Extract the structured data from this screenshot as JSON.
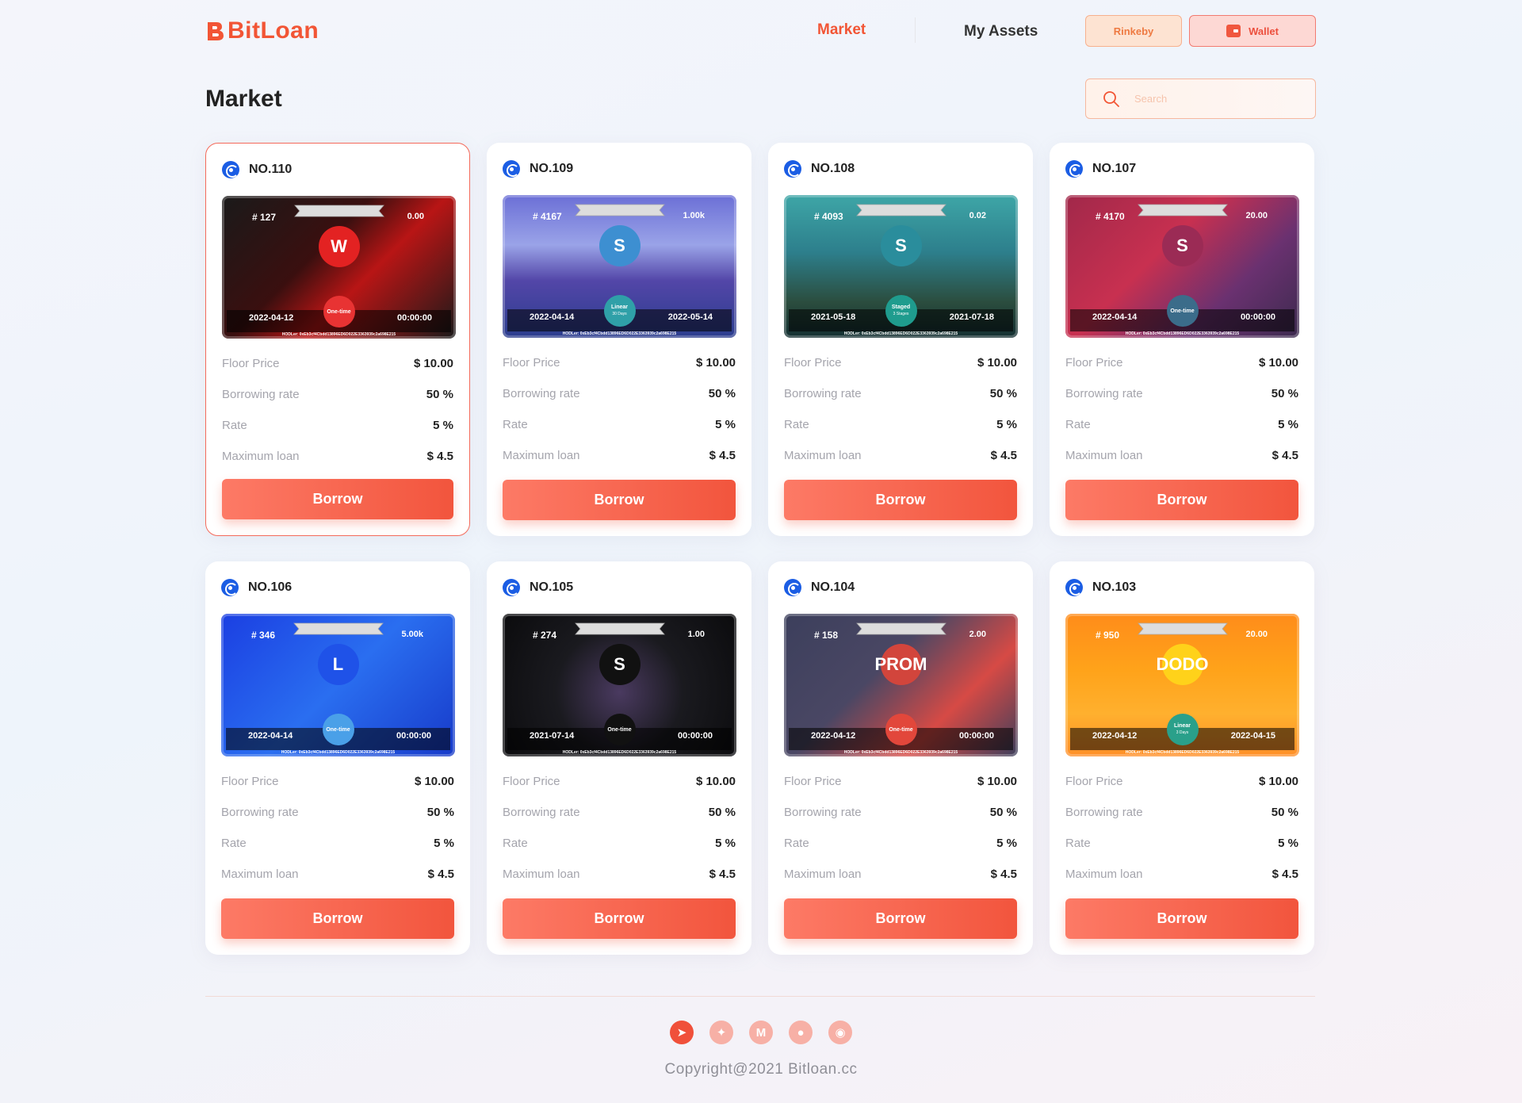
{
  "app": {
    "name": "BitLoan"
  },
  "header": {
    "nav": {
      "market": "Market",
      "my_assets": "My Assets"
    },
    "network_label": "Rinkeby",
    "wallet_label": "Wallet"
  },
  "page": {
    "title": "Market"
  },
  "search": {
    "placeholder": "Search",
    "value": ""
  },
  "card_labels": {
    "floor_price": "Floor Price",
    "borrowing_rate": "Borrowing rate",
    "rate": "Rate",
    "maximum_loan": "Maximum loan",
    "borrow_button": "Borrow"
  },
  "cards": [
    {
      "no": "NO.110",
      "token_id": "# 127",
      "value": "0.00",
      "date_start": "2022-04-12",
      "date_end": "00:00:00",
      "badge": "One-time",
      "badge_sub": "",
      "emblem": "W",
      "holder": "HODLer: 0xEb3cf4Cbdd13896ED6D022E3363939c2a698E215",
      "floor_price": "$ 10.00",
      "borrowing_rate": "50 %",
      "rate": "5 %",
      "maximum_loan": "$ 4.5",
      "theme": "red",
      "selected": true
    },
    {
      "no": "NO.109",
      "token_id": "# 4167",
      "value": "1.00k",
      "date_start": "2022-04-14",
      "date_end": "2022-05-14",
      "badge": "Linear",
      "badge_sub": "30 Days",
      "emblem": "S",
      "holder": "HODLer: 0xEb3cf4Cbdd13896ED6D022E3363939c2a698E215",
      "floor_price": "$ 10.00",
      "borrowing_rate": "50 %",
      "rate": "5 %",
      "maximum_loan": "$ 4.5",
      "theme": "purple",
      "selected": false
    },
    {
      "no": "NO.108",
      "token_id": "# 4093",
      "value": "0.02",
      "date_start": "2021-05-18",
      "date_end": "2021-07-18",
      "badge": "Staged",
      "badge_sub": "3 Stages",
      "emblem": "S",
      "holder": "HODLer: 0xEb3cf4Cbdd13896ED6D022E3363939c2a698E215",
      "floor_price": "$ 10.00",
      "borrowing_rate": "50 %",
      "rate": "5 %",
      "maximum_loan": "$ 4.5",
      "theme": "teal",
      "selected": false
    },
    {
      "no": "NO.107",
      "token_id": "# 4170",
      "value": "20.00",
      "date_start": "2022-04-14",
      "date_end": "00:00:00",
      "badge": "One-time",
      "badge_sub": "",
      "emblem": "S",
      "holder": "HODLer: 0xEb3cf4Cbdd13896ED6D022E3363939c2a698E215",
      "floor_price": "$ 10.00",
      "borrowing_rate": "50 %",
      "rate": "5 %",
      "maximum_loan": "$ 4.5",
      "theme": "crimson",
      "selected": false
    },
    {
      "no": "NO.106",
      "token_id": "# 346",
      "value": "5.00k",
      "date_start": "2022-04-14",
      "date_end": "00:00:00",
      "badge": "One-time",
      "badge_sub": "",
      "emblem": "L",
      "holder": "HODLer: 0xEb3cf4Cbdd13896ED6D022E3363939c2a698E215",
      "floor_price": "$ 10.00",
      "borrowing_rate": "50 %",
      "rate": "5 %",
      "maximum_loan": "$ 4.5",
      "theme": "blue",
      "selected": false
    },
    {
      "no": "NO.105",
      "token_id": "# 274",
      "value": "1.00",
      "date_start": "2021-07-14",
      "date_end": "00:00:00",
      "badge": "One-time",
      "badge_sub": "",
      "emblem": "S",
      "holder": "HODLer: 0xEb3cf4Cbdd13896ED6D022E3363939c2a698E215",
      "floor_price": "$ 10.00",
      "borrowing_rate": "50 %",
      "rate": "5 %",
      "maximum_loan": "$ 4.5",
      "theme": "black",
      "selected": false
    },
    {
      "no": "NO.104",
      "token_id": "# 158",
      "value": "2.00",
      "date_start": "2022-04-12",
      "date_end": "00:00:00",
      "badge": "One-time",
      "badge_sub": "",
      "emblem": "PROM",
      "holder": "HODLer: 0xEb3cf4Cbdd13896ED6D022E3363939c2a698E215",
      "floor_price": "$ 10.00",
      "borrowing_rate": "50 %",
      "rate": "5 %",
      "maximum_loan": "$ 4.5",
      "theme": "slate",
      "selected": false
    },
    {
      "no": "NO.103",
      "token_id": "# 950",
      "value": "20.00",
      "date_start": "2022-04-12",
      "date_end": "2022-04-15",
      "badge": "Linear",
      "badge_sub": "3 Days",
      "emblem": "DODO",
      "holder": "HODLer: 0xEb3cf4Cbdd13896ED6D022E3363939c2a698E215",
      "floor_price": "$ 10.00",
      "borrowing_rate": "50 %",
      "rate": "5 %",
      "maximum_loan": "$ 4.5",
      "theme": "orange",
      "selected": false
    }
  ],
  "themes": {
    "red": {
      "bg": "linear-gradient(135deg,#1a1a1a 0%,#3a0f0f 40%,#b81515 60%,#1a1a1a 100%)",
      "emblem": "#e32222",
      "badge": "#e83333"
    },
    "purple": {
      "bg": "linear-gradient(180deg,#6b6fd6 0%,#9aa3e8 35%,#5346a8 60%,#2b3d8e 100%)",
      "emblem": "#3d8fd1",
      "badge": "#2fa0a8"
    },
    "teal": {
      "bg": "linear-gradient(180deg,#3ea6a7 0%,#2d7f8c 40%,#2b4d3e 75%,#143032 100%)",
      "emblem": "#2a8d9c",
      "badge": "#1f9c8e"
    },
    "crimson": {
      "bg": "linear-gradient(135deg,#a1284a 0%,#c83050 40%,#6a3170 70%,#3c2a4e 100%)",
      "emblem": "#9b2b55",
      "badge": "#3b6c8a"
    },
    "blue": {
      "bg": "linear-gradient(135deg,#1b3fe2 0%,#2a6ef0 50%,#173ac9 100%)",
      "emblem": "#1f52e8",
      "badge": "#4aa0e8"
    },
    "black": {
      "bg": "radial-gradient(circle at 50% 55%,#4a3a60 0%,#1a1a1f 45%,#0b0b0d 100%)",
      "emblem": "#111",
      "badge": "#111"
    },
    "slate": {
      "bg": "linear-gradient(135deg,#3c3f5c 0%,#4a4764 40%,#d64a45 70%,#3c3f5c 100%)",
      "emblem": "#d2453c",
      "badge": "#e2473b"
    },
    "orange": {
      "bg": "linear-gradient(180deg,#ff8c1a 0%,#ffa31a 40%,#ffb02e 70%,#ff8f28 100%)",
      "emblem": "#ffd21a",
      "badge": "#2aa08a"
    }
  },
  "footer": {
    "social": [
      "telegram-icon",
      "twitter-icon",
      "medium-icon",
      "discord-icon",
      "github-icon"
    ],
    "copyright": "Copyright@2021 Bitloan.cc"
  }
}
